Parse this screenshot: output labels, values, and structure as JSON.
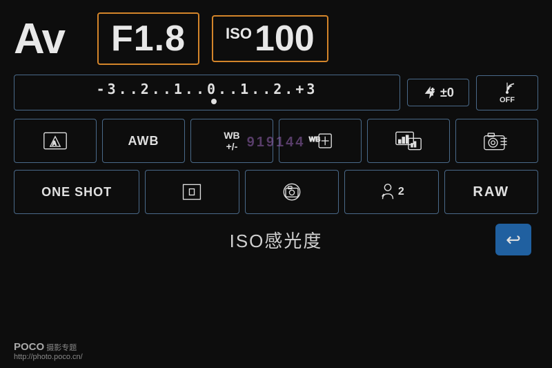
{
  "mode": "Av",
  "aperture": "F1.8",
  "iso_label": "ISO",
  "iso_value": "100",
  "exposure": {
    "scale": "⁻3..2..1..◌..1..2.⁺3",
    "display": "-3..2..1..0..1..2.+3"
  },
  "flash": "±0",
  "wifi": "OFF",
  "watermark": "919144",
  "row3": [
    {
      "id": "metering",
      "label": "Metering A"
    },
    {
      "id": "awb",
      "label": "AWB"
    },
    {
      "id": "wb-adj",
      "label": "WB +/-"
    },
    {
      "id": "wb-shift",
      "label": "WB Shift"
    },
    {
      "id": "display",
      "label": "Display"
    },
    {
      "id": "camera-settings",
      "label": "Camera Settings"
    }
  ],
  "row4": [
    {
      "id": "one-shot",
      "label": "ONE SHOT"
    },
    {
      "id": "center-af",
      "label": "Center AF"
    },
    {
      "id": "live-view",
      "label": "Live View"
    },
    {
      "id": "timer",
      "label": "Timer 2s"
    },
    {
      "id": "raw",
      "label": "RAW"
    }
  ],
  "iso_sensitivity_label": "ISO感光度",
  "back_button_label": "↩",
  "logo_brand": "POCO",
  "logo_tagline": "摄影专题",
  "logo_url": "http://photo.poco.cn/"
}
